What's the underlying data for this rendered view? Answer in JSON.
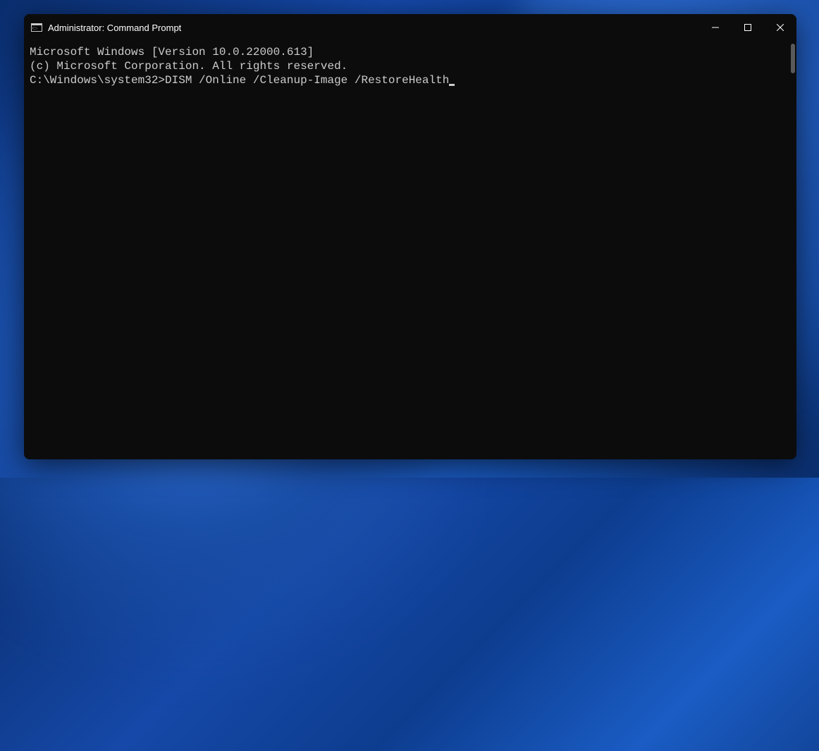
{
  "window": {
    "title": "Administrator: Command Prompt"
  },
  "terminal": {
    "line1": "Microsoft Windows [Version 10.0.22000.613]",
    "line2": "(c) Microsoft Corporation. All rights reserved.",
    "blank": "",
    "prompt": "C:\\Windows\\system32>",
    "command": "DISM /Online /Cleanup-Image /RestoreHealth"
  }
}
